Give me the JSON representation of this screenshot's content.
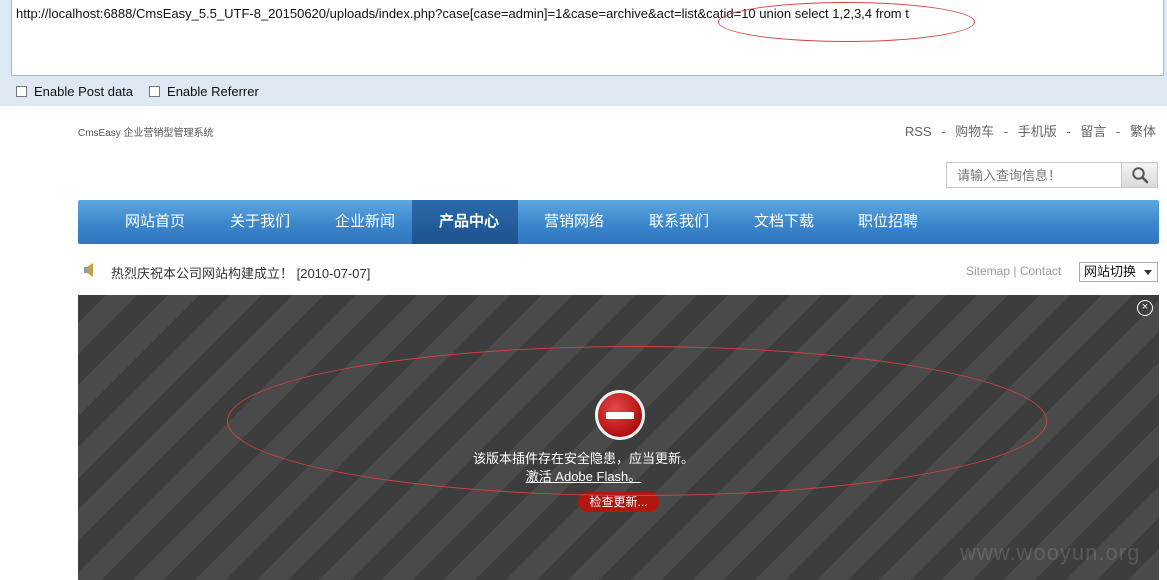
{
  "url": "http://localhost:6888/CmsEasy_5.5_UTF-8_20150620/uploads/index.php?case[case=admin]=1&case=archive&act=list&catid=10 union select 1,2,3,4 from t",
  "options": {
    "post_data": "Enable Post data",
    "referrer": "Enable Referrer"
  },
  "site": {
    "logo": "CmsEasy 企业营销型管理系统",
    "top_links": [
      "RSS",
      "购物车",
      "手机版",
      "留言",
      "繁体"
    ],
    "top_separators": [
      "-",
      "-",
      "-",
      "-"
    ],
    "search_placeholder": "请输入查询信息！"
  },
  "nav": {
    "items": [
      "网站首页",
      "关于我们",
      "企业新闻",
      "产品中心",
      "营销网络",
      "联系我们",
      "文档下载",
      "职位招聘"
    ],
    "active_index": 3
  },
  "notice": {
    "text": "热烈庆祝本公司网站构建成立！ [2010-07-07]",
    "sitemap": "Sitemap",
    "sep": "|",
    "contact": "Contact",
    "language": "网站切换"
  },
  "flash": {
    "message": "该版本插件存在安全隐患，应当更新。",
    "activate": "激活 Adobe Flash。",
    "update_button": "检查更新...",
    "close": "×",
    "watermark": "www.wooyun.org"
  },
  "colors": {
    "nav_blue": "#3b86cc",
    "nav_active": "#1d528e",
    "block_red": "#b10f0f",
    "annotation_red": "#d94040"
  },
  "icons": {
    "search": "search-icon",
    "block": "block-icon",
    "close": "close-icon",
    "notice": "speaker-icon"
  }
}
